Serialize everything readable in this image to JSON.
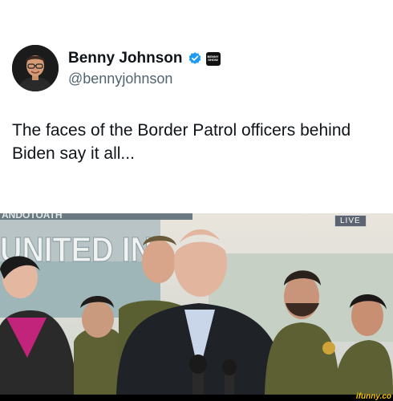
{
  "author": {
    "name": "Benny Johnson",
    "handle": "@bennyjohnson",
    "affiliation_badge": "BENNY SHOW",
    "verified_icon": "verified-badge-icon",
    "colors": {
      "verified": "#1d9bf0"
    }
  },
  "tweet": {
    "text": "The faces of the Border Patrol officers behind Biden say it all..."
  },
  "media": {
    "live_badge": "LIVE",
    "backdrop_line1": "ANDOTOATH",
    "backdrop_line2": "UNITED IN"
  },
  "footer": {
    "watermark": "ifunny.co"
  }
}
